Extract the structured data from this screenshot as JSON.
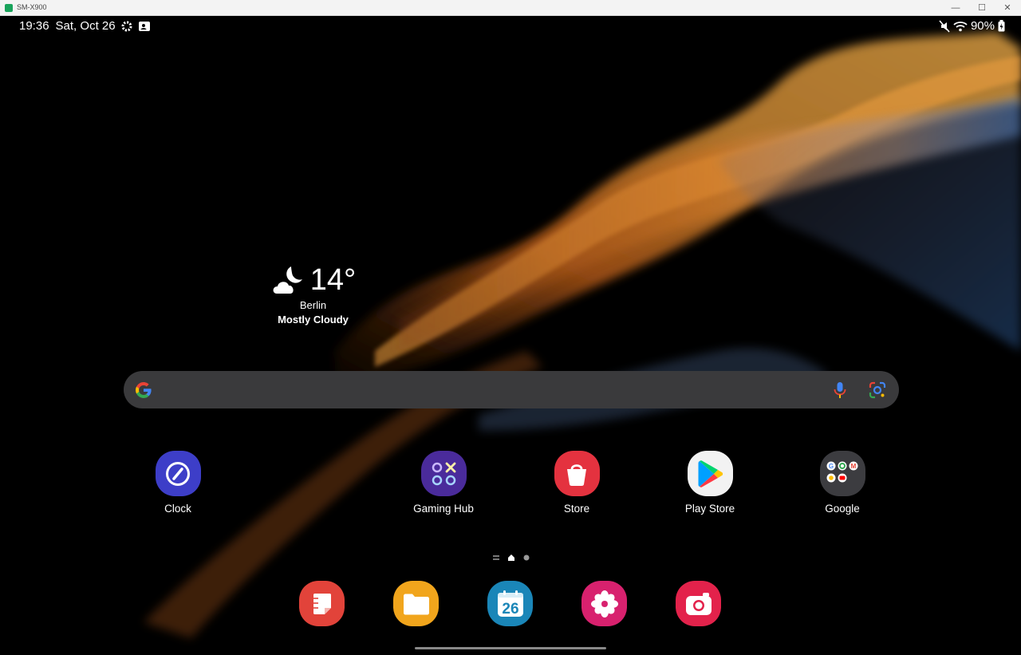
{
  "window": {
    "title": "SM-X900"
  },
  "status": {
    "time": "19:36",
    "date": "Sat, Oct 26",
    "battery": "90%"
  },
  "weather": {
    "temp": "14°",
    "city": "Berlin",
    "condition": "Mostly Cloudy"
  },
  "apps": [
    {
      "label": "Clock",
      "icon": "clock-icon",
      "color": "#3d3ec8"
    },
    {
      "label": "Gaming Hub",
      "icon": "gaming-hub-icon",
      "color": "#4a2b9b"
    },
    {
      "label": "Store",
      "icon": "galaxy-store-icon",
      "color": "#e4323f"
    },
    {
      "label": "Play Store",
      "icon": "play-store-icon",
      "color": "#f2f2f2"
    },
    {
      "label": "Google",
      "icon": "google-folder-icon",
      "color": "#3c3c40"
    }
  ],
  "dock": [
    {
      "icon": "notes-icon",
      "color": "#e2433a"
    },
    {
      "icon": "my-files-icon",
      "color": "#f1a51c"
    },
    {
      "icon": "calendar-icon",
      "color": "#1a86b8",
      "text": "26"
    },
    {
      "icon": "gallery-icon",
      "color": "#d8216e"
    },
    {
      "icon": "camera-icon",
      "color": "#e3224b"
    }
  ]
}
